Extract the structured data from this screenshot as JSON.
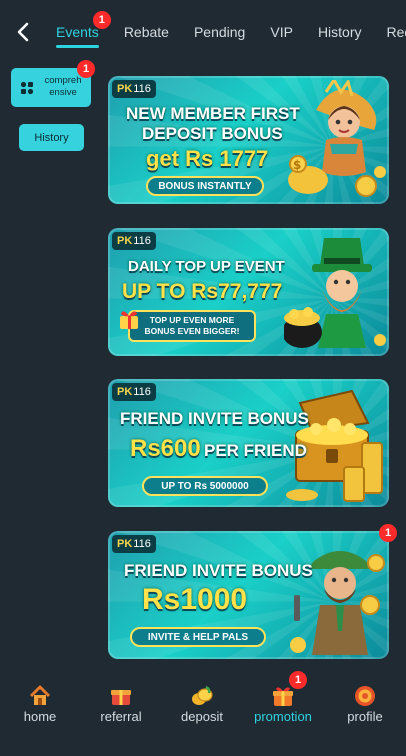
{
  "header": {
    "tabs": [
      {
        "label": "Events",
        "active": true,
        "badge": "1"
      },
      {
        "label": "Rebate"
      },
      {
        "label": "Pending"
      },
      {
        "label": "VIP"
      },
      {
        "label": "History"
      },
      {
        "label": "Rede"
      }
    ]
  },
  "filters": {
    "comprehensive": {
      "label": "compreh ensive",
      "badge": "1"
    },
    "history": {
      "label": "History"
    }
  },
  "banners": [
    {
      "brand": "PK",
      "brand_num": "116",
      "line1": "NEW MEMBER FIRST",
      "line2": "DEPOSIT BONUS",
      "line3": "get Rs 1777",
      "button": "BONUS INSTANTLY"
    },
    {
      "brand": "PK",
      "brand_num": "116",
      "line1": "DAILY TOP UP EVENT",
      "line2": "UP TO Rs77,777",
      "sub1": "TOP UP EVEN MORE",
      "sub2": "BONUS EVEN BIGGER!"
    },
    {
      "brand": "PK",
      "brand_num": "116",
      "line1": "FRIEND INVITE BONUS",
      "line2": "Rs600",
      "line2b": "PER FRIEND",
      "button": "UP TO Rs 5000000"
    },
    {
      "brand": "PK",
      "brand_num": "116",
      "line1": "FRIEND INVITE BONUS",
      "line2": "Rs1000",
      "button": "INVITE & HELP PALS",
      "badge": "1"
    }
  ],
  "bottom_nav": [
    {
      "label": "home",
      "icon": "home-icon"
    },
    {
      "label": "referral",
      "icon": "gift-box-icon"
    },
    {
      "label": "deposit",
      "icon": "coins-icon"
    },
    {
      "label": "promotion",
      "icon": "present-icon",
      "active": true,
      "badge": "1"
    },
    {
      "label": "profile",
      "icon": "profile-icon"
    }
  ],
  "colors": {
    "background": "#1f2a33",
    "accent": "#2ed3e0",
    "badge": "#ff2a2a",
    "gold": "#ffe24a"
  }
}
